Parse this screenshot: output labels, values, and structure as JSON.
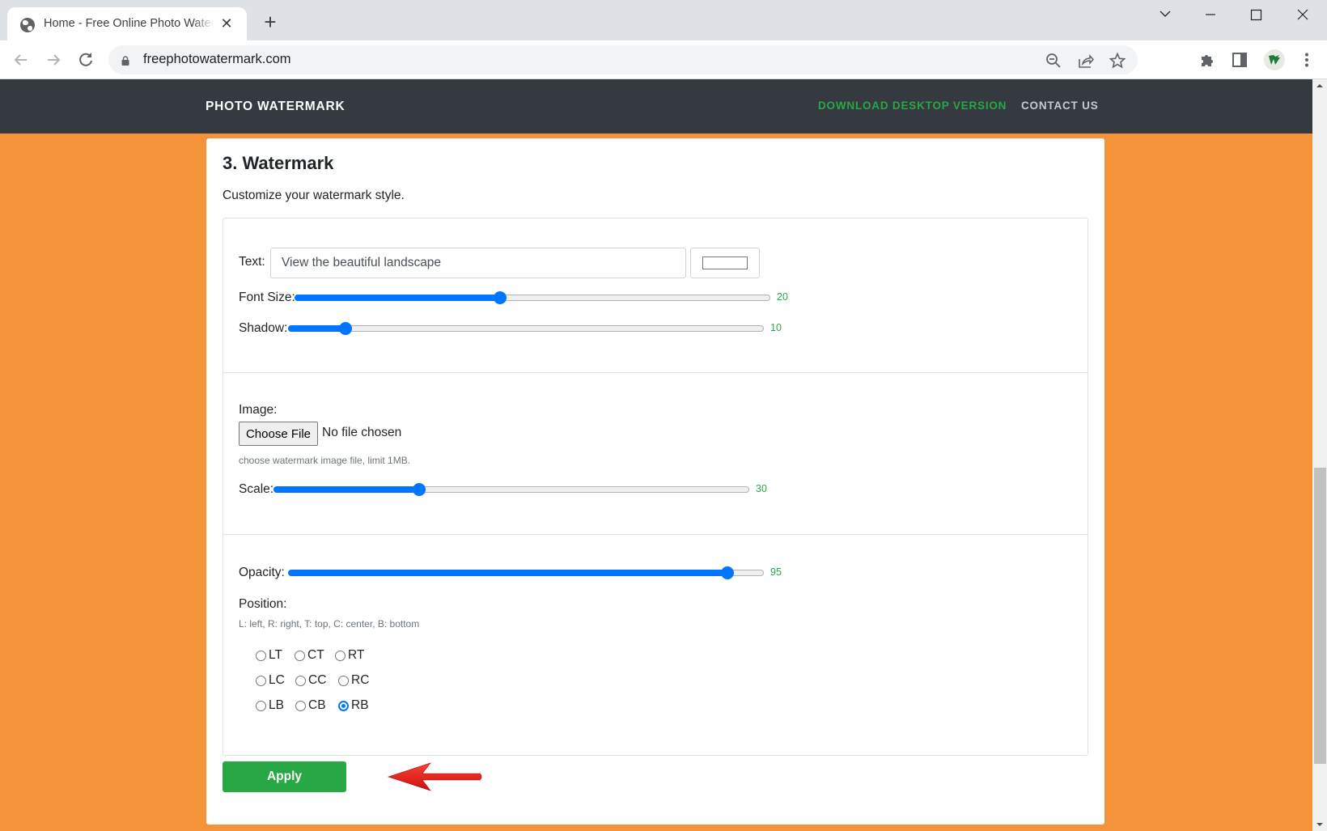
{
  "browser": {
    "tab_title": "Home - Free Online Photo Watermark",
    "url": "freephotowatermark.com",
    "icons": {
      "tab_favicon": "globe-icon",
      "tab_close": "close-icon",
      "new_tab": "plus-icon",
      "back": "arrow-left-icon",
      "forward": "arrow-right-icon",
      "reload": "reload-icon",
      "lock": "lock-icon",
      "zoom": "zoom-out-icon",
      "share": "share-icon",
      "bookmark": "star-icon",
      "extensions": "puzzle-icon",
      "side_panel": "side-panel-icon",
      "profile": "avatar",
      "menu": "kebab-menu-icon"
    },
    "close_glyph": "✕",
    "plus_glyph": "+"
  },
  "navbar": {
    "brand": "PHOTO WATERMARK",
    "links": [
      {
        "label": "DOWNLOAD DESKTOP VERSION",
        "color": "#28a745"
      },
      {
        "label": "CONTACT US",
        "color": "#c8c9cb"
      }
    ],
    "background": "#343a40"
  },
  "page": {
    "background": "#f4933a"
  },
  "section": {
    "title": "3. Watermark",
    "subtitle": "Customize your watermark style."
  },
  "text_panel": {
    "text_label": "Text:",
    "text_value": "View the beautiful landscape",
    "font_size": {
      "label": "Font Size:",
      "value": "20",
      "fraction": 0.43
    },
    "shadow": {
      "label": "Shadow:",
      "value": "10",
      "fraction": 0.11
    }
  },
  "image_panel": {
    "image_label": "Image:",
    "choose_file_label": "Choose File",
    "no_file_text": "No file chosen",
    "help_text": "choose watermark image file, limit 1MB.",
    "scale": {
      "label": "Scale:",
      "value": "30",
      "fraction": 0.3
    }
  },
  "position_panel": {
    "opacity": {
      "label": "Opacity:",
      "value": "95",
      "fraction": 0.935
    },
    "position_label": "Position:",
    "legend": "L: left, R: right, T: top, C: center, B: bottom",
    "options": [
      [
        {
          "label": "LT",
          "checked": false
        },
        {
          "label": "CT",
          "checked": false
        },
        {
          "label": "RT",
          "checked": false
        }
      ],
      [
        {
          "label": "LC",
          "checked": false
        },
        {
          "label": "CC",
          "checked": false
        },
        {
          "label": "RC",
          "checked": false
        }
      ],
      [
        {
          "label": "LB",
          "checked": false
        },
        {
          "label": "CB",
          "checked": false
        },
        {
          "label": "RB",
          "checked": true
        }
      ]
    ],
    "selected": "RB"
  },
  "apply_button": {
    "label": "Apply",
    "color": "#28a745"
  },
  "annotation": {
    "type": "red-arrow",
    "points_to": "Apply",
    "color": "#e8120c"
  },
  "accent_color": "#0075ff"
}
